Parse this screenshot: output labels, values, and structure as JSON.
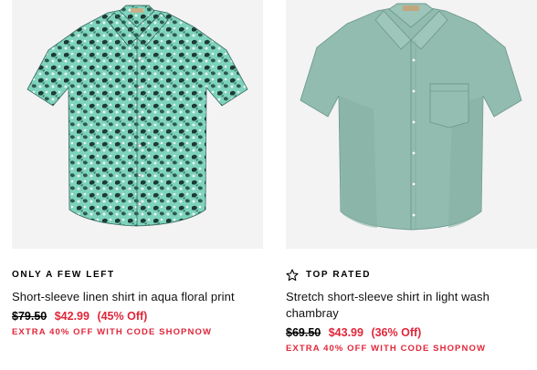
{
  "products": [
    {
      "badge": "ONLY A FEW LEFT",
      "name": "Short-sleeve linen shirt in aqua floral print",
      "was_price": "$79.50",
      "now_price": "$42.99",
      "discount": "(45% Off)",
      "promo": "EXTRA 40% OFF WITH CODE SHOPNOW",
      "image_label": "aqua floral print shirt"
    },
    {
      "badge": "TOP RATED",
      "badge_icon": "star-outline-icon",
      "name": "Stretch short-sleeve shirt in light wash chambray",
      "was_price": "$69.50",
      "now_price": "$43.99",
      "discount": "(36% Off)",
      "promo": "EXTRA 40% OFF WITH CODE SHOPNOW",
      "image_label": "light wash chambray shirt"
    }
  ],
  "colors": {
    "sale_red": "#e0263a",
    "image_bg": "#f3f3f3",
    "floral_base": "#6fcbb3",
    "floral_dark": "#1d3b33",
    "chambray": "#8fb8ac"
  }
}
